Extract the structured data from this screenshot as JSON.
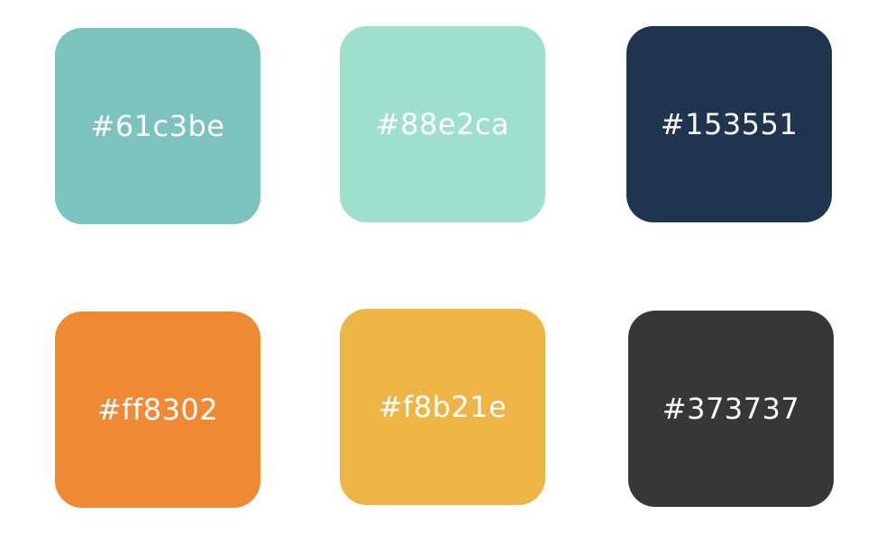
{
  "swatches": [
    {
      "label": "#61c3be",
      "color": "#7cc2be"
    },
    {
      "label": "#88e2ca",
      "color": "#9fe0cc"
    },
    {
      "label": "#153551",
      "color": "#1f344f"
    },
    {
      "label": "#ff8302",
      "color": "#f08934"
    },
    {
      "label": "#f8b21e",
      "color": "#edb446"
    },
    {
      "label": "#373737",
      "color": "#373737"
    }
  ]
}
